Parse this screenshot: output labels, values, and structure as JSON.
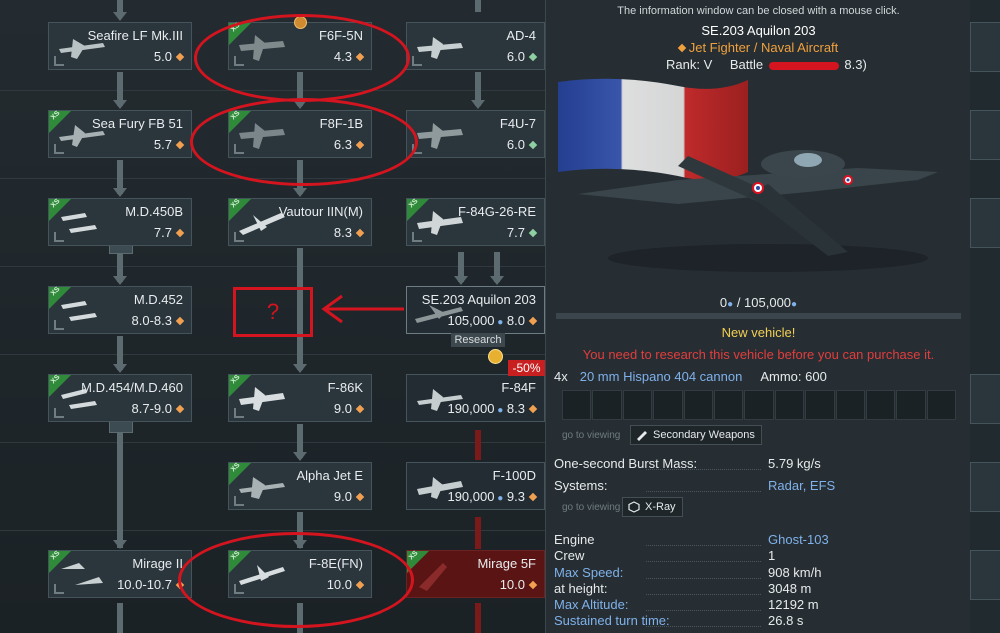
{
  "tree": {
    "cards": [
      {
        "id": "seafire",
        "name": "Seafire LF Mk.III",
        "br": "5.0"
      },
      {
        "id": "f6f",
        "name": "F6F-5N",
        "br": "4.3"
      },
      {
        "id": "ad4",
        "name": "AD-4",
        "br": "6.0"
      },
      {
        "id": "seafury",
        "name": "Sea Fury FB 51",
        "br": "5.7"
      },
      {
        "id": "f8f",
        "name": "F8F-1B",
        "br": "6.3"
      },
      {
        "id": "f4u",
        "name": "F4U-7",
        "br": "6.0"
      },
      {
        "id": "md450b",
        "name": "M.D.450B",
        "br": "7.7"
      },
      {
        "id": "vautour",
        "name": "Vautour IIN(M)",
        "br": "8.3"
      },
      {
        "id": "f84g",
        "name": "F-84G-26-RE",
        "br": "7.7"
      },
      {
        "id": "md452",
        "name": "M.D.452",
        "br": "8.0-8.3"
      },
      {
        "id": "se203",
        "name": "SE.203 Aquilon 203",
        "rp": "105,000",
        "br": "8.0"
      },
      {
        "id": "md454",
        "name": "M.D.454/M.D.460",
        "br": "8.7-9.0"
      },
      {
        "id": "f86k",
        "name": "F-86K",
        "br": "9.0"
      },
      {
        "id": "f84f",
        "name": "F-84F",
        "rp": "190,000",
        "br": "8.3"
      },
      {
        "id": "alpha",
        "name": "Alpha Jet E",
        "br": "9.0"
      },
      {
        "id": "f100d",
        "name": "F-100D",
        "rp": "190,000",
        "br": "9.3"
      },
      {
        "id": "mirage2",
        "name": "Mirage II",
        "br": "10.0-10.7"
      },
      {
        "id": "f8e",
        "name": "F-8E(FN)",
        "br": "10.0"
      },
      {
        "id": "mirage5f",
        "name": "Mirage 5F",
        "br": "10.0"
      }
    ],
    "research_label": "Research",
    "discount": "-50%",
    "question_mark": "?",
    "xs_badge": "XS"
  },
  "panel": {
    "tip": "The information window can be closed with a mouse click.",
    "title": "SE.203 Aquilon 203",
    "subtitle": "Jet Fighter / Naval Aircraft",
    "rank_label": "Rank:",
    "rank_value": "V",
    "battle_label": "Battle",
    "battle_value": "8.3)",
    "research_progress": "0",
    "research_total": "/ 105,000",
    "new_vehicle": "New vehicle!",
    "warning": "You need to research this vehicle before you can purchase it.",
    "weapon_count": "4x",
    "weapon_name": "20 mm Hispano 404 cannon",
    "ammo": "Ammo:  600",
    "goto_viewing": "go to viewing",
    "secondary_weapons": "Secondary Weapons",
    "xray": "X-Ray",
    "stats": [
      {
        "label": "One-second Burst Mass:",
        "value": "5.79 kg/s",
        "blue": false,
        "vblue": false
      },
      {
        "label": "Systems:",
        "value": "Radar, EFS",
        "blue": false,
        "vblue": true
      },
      {
        "label": "Engine",
        "value": "Ghost-103",
        "blue": false,
        "vblue": true
      },
      {
        "label": "Crew",
        "value": "1",
        "blue": false,
        "vblue": false
      },
      {
        "label": "Max Speed:",
        "value": "908 km/h",
        "blue": true,
        "vblue": false
      },
      {
        "label": "at height:",
        "value": "3048 m",
        "blue": false,
        "vblue": false
      },
      {
        "label": "Max Altitude:",
        "value": "12192 m",
        "blue": true,
        "vblue": false
      },
      {
        "label": "Sustained turn time:",
        "value": "26.8 s",
        "blue": true,
        "vblue": false
      }
    ]
  },
  "colors": {
    "accent_orange": "#f0a03c",
    "link_blue": "#7fb1ea",
    "warning_red": "#e23d3d",
    "new_yellow": "#f3cf52",
    "annotation_red": "#d4141e"
  }
}
